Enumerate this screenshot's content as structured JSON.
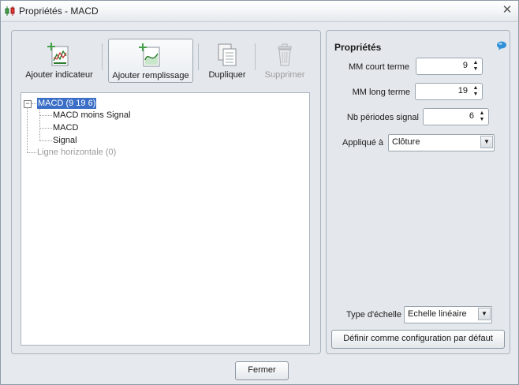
{
  "window": {
    "title": "Propriétés - MACD",
    "app_icon": "candlestick-chart-icon",
    "close_icon": "close-icon"
  },
  "toolbar": {
    "add_indicator": {
      "label": "Ajouter indicateur",
      "icon": "add-indicator-icon"
    },
    "add_fill": {
      "label": "Ajouter remplissage",
      "icon": "add-fill-icon"
    },
    "duplicate": {
      "label": "Dupliquer",
      "icon": "duplicate-icon"
    },
    "delete": {
      "label": "Supprimer",
      "icon": "trash-icon"
    }
  },
  "tree": {
    "root": {
      "label": "MACD (9 19 6)",
      "expander": "−"
    },
    "children": [
      "MACD moins Signal",
      "MACD",
      "Signal"
    ],
    "other": "Ligne horizontale (0)"
  },
  "properties": {
    "title": "Propriétés",
    "help_icon": "help-bubble-icon",
    "short_ma": {
      "label": "MM court terme",
      "value": "9"
    },
    "long_ma": {
      "label": "MM long terme",
      "value": "19"
    },
    "signal_periods": {
      "label": "Nb périodes signal",
      "value": "6"
    },
    "applied_to": {
      "label": "Appliqué à",
      "value": "Clôture"
    },
    "scale_type": {
      "label": "Type d'échelle",
      "value": "Echelle linéaire"
    },
    "default_button": "Définir comme configuration par défaut"
  },
  "footer": {
    "close_button": "Fermer"
  },
  "colors": {
    "selection": "#3b6fc7",
    "panel_bg": "#e4e8ec",
    "window_bg": "#e6eaee"
  }
}
